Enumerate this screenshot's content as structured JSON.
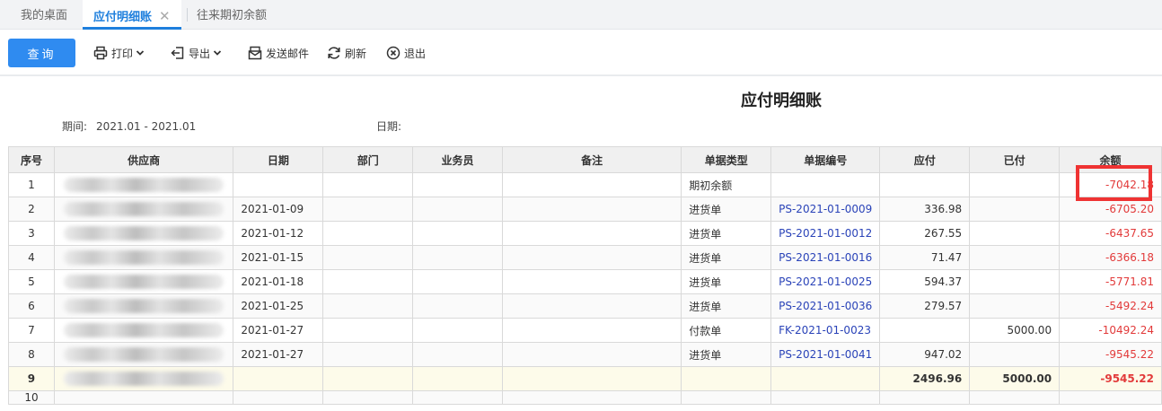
{
  "tabs": [
    {
      "label": "我的桌面",
      "active": false
    },
    {
      "label": "应付明细账",
      "active": true,
      "closable": true
    },
    {
      "label": "往来期初余额",
      "active": false
    }
  ],
  "toolbar": {
    "query": "查询",
    "print": "打印",
    "export": "导出",
    "email": "发送邮件",
    "refresh": "刷新",
    "exit": "退出"
  },
  "report": {
    "title": "应付明细账",
    "period_label": "期间:",
    "period_value": "2021.01 - 2021.01",
    "date_label": "日期:"
  },
  "table": {
    "columns": [
      "序号",
      "供应商",
      "日期",
      "部门",
      "业务员",
      "备注",
      "单据类型",
      "单据编号",
      "应付",
      "已付",
      "余额"
    ],
    "rows": [
      {
        "no": "1",
        "date": "",
        "dept": "",
        "staff": "",
        "note": "",
        "type": "期初余额",
        "code": "",
        "payable": "",
        "paid": "",
        "balance": "-7042.18"
      },
      {
        "no": "2",
        "date": "2021-01-09",
        "dept": "",
        "staff": "",
        "note": "",
        "type": "进货单",
        "code": "PS-2021-01-0009",
        "payable": "336.98",
        "paid": "",
        "balance": "-6705.20"
      },
      {
        "no": "3",
        "date": "2021-01-12",
        "dept": "",
        "staff": "",
        "note": "",
        "type": "进货单",
        "code": "PS-2021-01-0012",
        "payable": "267.55",
        "paid": "",
        "balance": "-6437.65"
      },
      {
        "no": "4",
        "date": "2021-01-15",
        "dept": "",
        "staff": "",
        "note": "",
        "type": "进货单",
        "code": "PS-2021-01-0016",
        "payable": "71.47",
        "paid": "",
        "balance": "-6366.18"
      },
      {
        "no": "5",
        "date": "2021-01-18",
        "dept": "",
        "staff": "",
        "note": "",
        "type": "进货单",
        "code": "PS-2021-01-0025",
        "payable": "594.37",
        "paid": "",
        "balance": "-5771.81"
      },
      {
        "no": "6",
        "date": "2021-01-25",
        "dept": "",
        "staff": "",
        "note": "",
        "type": "进货单",
        "code": "PS-2021-01-0036",
        "payable": "279.57",
        "paid": "",
        "balance": "-5492.24"
      },
      {
        "no": "7",
        "date": "2021-01-27",
        "dept": "",
        "staff": "",
        "note": "",
        "type": "付款单",
        "code": "FK-2021-01-0023",
        "payable": "",
        "paid": "5000.00",
        "balance": "-10492.24"
      },
      {
        "no": "8",
        "date": "2021-01-27",
        "dept": "",
        "staff": "",
        "note": "",
        "type": "进货单",
        "code": "PS-2021-01-0041",
        "payable": "947.02",
        "paid": "",
        "balance": "-9545.22"
      }
    ],
    "total": {
      "no": "9",
      "payable": "2496.96",
      "paid": "5000.00",
      "balance": "-9545.22"
    },
    "next_row_no": "10"
  },
  "colors": {
    "accent": "#2f8bf0",
    "tab_active": "#1e7fdd",
    "negative": "#e23a3a",
    "link": "#2a43b8",
    "highlight": "#ef3333",
    "total_row_bg": "#fdfbea"
  },
  "icons": [
    "close-icon",
    "printer-icon",
    "export-icon",
    "mail-icon",
    "refresh-icon",
    "exit-circle-icon",
    "chevron-down-icon"
  ]
}
